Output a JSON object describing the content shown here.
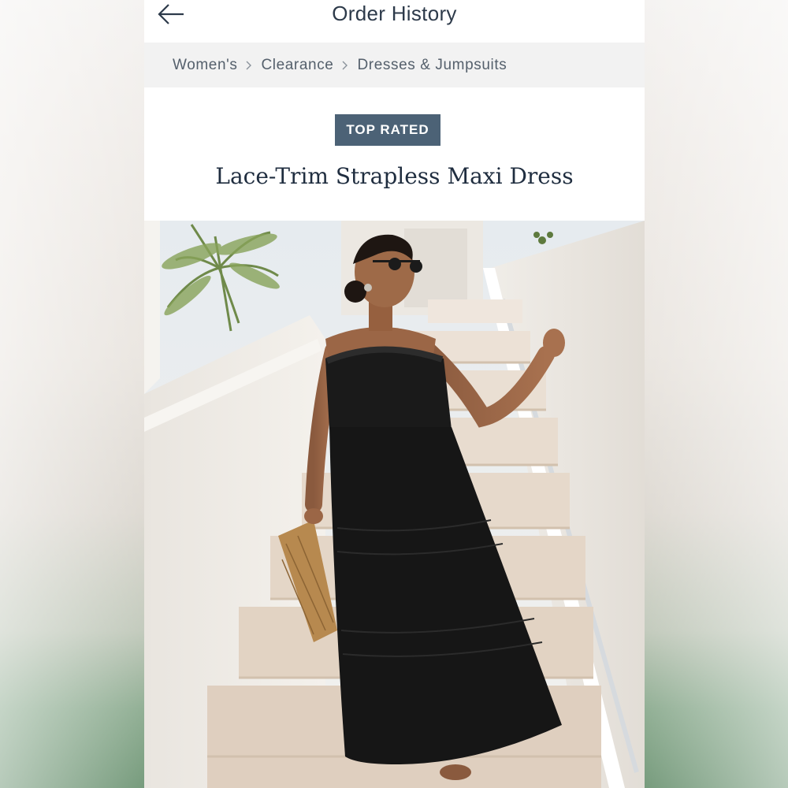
{
  "header": {
    "title": "Order History",
    "back_icon": "arrow-left-icon"
  },
  "breadcrumb": {
    "items": [
      {
        "label": "Women's"
      },
      {
        "label": "Clearance"
      },
      {
        "label": "Dresses & Jumpsuits"
      }
    ],
    "separator_icon": "chevron-right-icon"
  },
  "product": {
    "badge": "TOP RATED",
    "name": "Lace-Trim Strapless Maxi Dress",
    "image_alt": "Model in black strapless maxi dress walking down white stairs"
  },
  "colors": {
    "badge_bg": "#4c6276",
    "title_text": "#1f2d3f",
    "breadcrumb_bg": "#f2f2f2",
    "dress": "#1a1a1a"
  }
}
